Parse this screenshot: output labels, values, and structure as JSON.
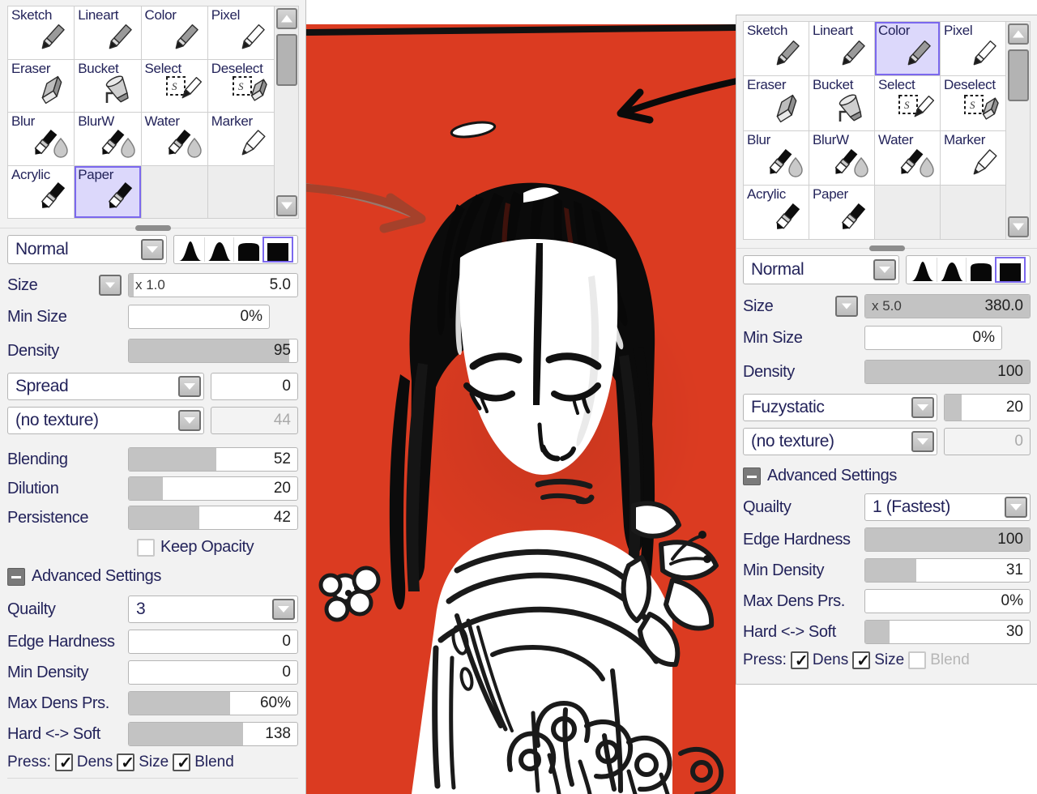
{
  "app": {
    "canvas_background_color": "#DB3B21",
    "selection_highlight_color": "#7b68ee"
  },
  "tools": {
    "labels": [
      "Sketch",
      "Lineart",
      "Color",
      "Pixel",
      "Eraser",
      "Bucket",
      "Select",
      "Deselect",
      "Blur",
      "BlurW",
      "Water",
      "Marker",
      "Acrylic",
      "Paper"
    ],
    "icons": [
      "pencil-icon",
      "pencil-icon",
      "pencil-icon",
      "pencil-outline-icon",
      "eraser-icon",
      "bucket-icon",
      "select-pen-icon",
      "deselect-eraser-icon",
      "blur-brush-icon",
      "blurw-brush-icon",
      "water-brush-icon",
      "marker-icon",
      "acrylic-brush-icon",
      "paper-brush-icon"
    ]
  },
  "left_panel": {
    "selected_tool": "Paper",
    "blend_mode": "Normal",
    "shape_icons": [
      "soft-round-shape",
      "medium-round-shape",
      "hard-round-shape",
      "flat-square-shape"
    ],
    "selected_shape_index": 3,
    "size": {
      "label": "Size",
      "multiplier": "x 1.0",
      "value": "5.0",
      "fill_percent": 3
    },
    "min_size": {
      "label": "Min Size",
      "value": "0%",
      "fill_percent": 0
    },
    "density": {
      "label": "Density",
      "value": "95",
      "fill_percent": 95
    },
    "spread": {
      "label": "Spread",
      "value": "0",
      "fill_percent": 0
    },
    "texture": {
      "label": "(no texture)",
      "value": "44",
      "fill_percent": 0,
      "disabled": true
    },
    "blending": {
      "label": "Blending",
      "value": "52",
      "fill_percent": 52
    },
    "dilution": {
      "label": "Dilution",
      "value": "20",
      "fill_percent": 20
    },
    "persistence": {
      "label": "Persistence",
      "value": "42",
      "fill_percent": 42
    },
    "keep_opacity": {
      "label": "Keep Opacity",
      "checked": false
    },
    "advanced": {
      "title": "Advanced Settings",
      "expanded": true,
      "quality": {
        "label": "Quailty",
        "value": "3"
      },
      "edge_hardness": {
        "label": "Edge Hardness",
        "value": "0",
        "fill_percent": 0
      },
      "min_density": {
        "label": "Min Density",
        "value": "0",
        "fill_percent": 0
      },
      "max_dens_prs": {
        "label": "Max Dens Prs.",
        "value": "60%",
        "fill_percent": 60
      },
      "hard_soft": {
        "label": "Hard <-> Soft",
        "value": "138",
        "fill_percent": 68
      }
    },
    "press": {
      "label": "Press:",
      "dens": {
        "label": "Dens",
        "checked": true
      },
      "size": {
        "label": "Size",
        "checked": true
      },
      "blend": {
        "label": "Blend",
        "checked": true
      }
    }
  },
  "right_panel": {
    "selected_tool": "Color",
    "blend_mode": "Normal",
    "shape_icons": [
      "soft-round-shape",
      "medium-round-shape",
      "hard-round-shape",
      "flat-square-shape"
    ],
    "selected_shape_index": 3,
    "size": {
      "label": "Size",
      "multiplier": "x 5.0",
      "value": "380.0",
      "fill_percent": 100
    },
    "min_size": {
      "label": "Min Size",
      "value": "0%",
      "fill_percent": 0
    },
    "density": {
      "label": "Density",
      "value": "100",
      "fill_percent": 100
    },
    "effect": {
      "label": "Fuzystatic",
      "value": "20",
      "fill_percent": 20
    },
    "texture": {
      "label": "(no texture)",
      "value": "0",
      "fill_percent": 0,
      "disabled": true
    },
    "advanced": {
      "title": "Advanced Settings",
      "expanded": true,
      "quality": {
        "label": "Quailty",
        "value": "1 (Fastest)"
      },
      "edge_hardness": {
        "label": "Edge Hardness",
        "value": "100",
        "fill_percent": 100
      },
      "min_density": {
        "label": "Min Density",
        "value": "31",
        "fill_percent": 31
      },
      "max_dens_prs": {
        "label": "Max Dens Prs.",
        "value": "0%",
        "fill_percent": 0
      },
      "hard_soft": {
        "label": "Hard <-> Soft",
        "value": "30",
        "fill_percent": 15
      }
    },
    "press": {
      "label": "Press:",
      "dens": {
        "label": "Dens",
        "checked": true
      },
      "size": {
        "label": "Size",
        "checked": true
      },
      "blend": {
        "label": "Blend",
        "checked": false
      }
    }
  },
  "annotations": {
    "arrow_from_color_tool": "black-arrow-pointing-to-red-background",
    "arrow_from_paper_tool": "red-arrow-pointing-to-hair"
  }
}
